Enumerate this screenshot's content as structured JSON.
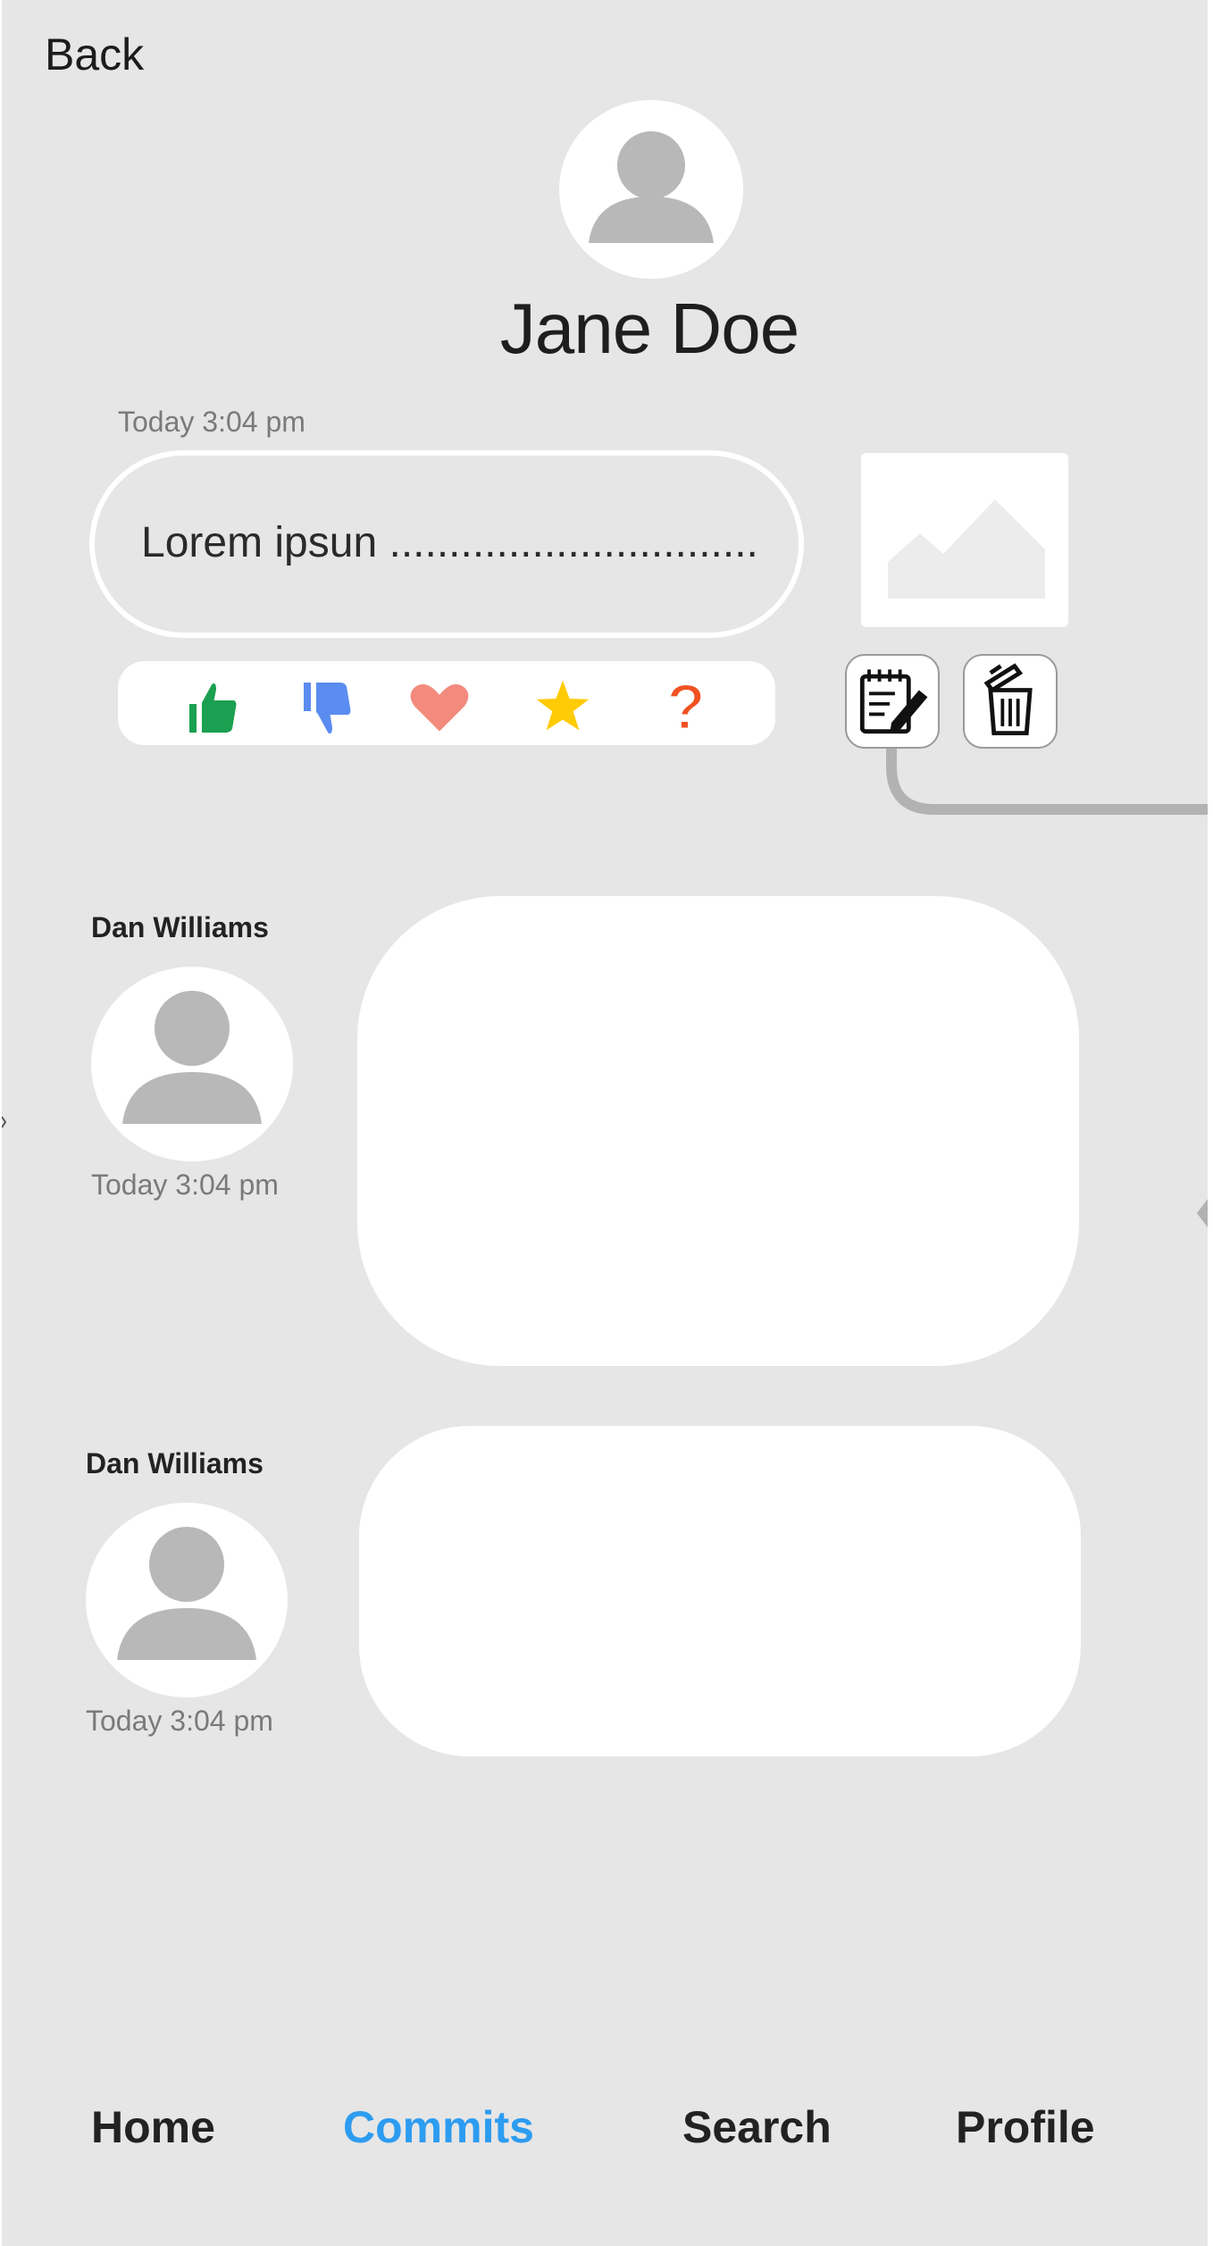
{
  "header": {
    "back_label": "Back"
  },
  "profile": {
    "name": "Jane Doe",
    "avatar_icon": "user-avatar-icon"
  },
  "post": {
    "timestamp": "Today 3:04 pm",
    "text": "Lorem ipsun ...............................",
    "image_icon": "image-placeholder-icon",
    "reactions": [
      {
        "icon": "thumbs-up-icon",
        "color": "#1aa050"
      },
      {
        "icon": "thumbs-down-icon",
        "color": "#5b8cf0"
      },
      {
        "icon": "heart-icon",
        "color": "#f38a7e"
      },
      {
        "icon": "star-icon",
        "color": "#ffcb05"
      },
      {
        "icon": "question-icon",
        "color": "#f05222"
      }
    ],
    "actions": [
      {
        "icon": "edit-notepad-icon"
      },
      {
        "icon": "delete-trash-icon"
      }
    ]
  },
  "comments": [
    {
      "author": "Dan Williams",
      "timestamp": "Today 3:04 pm",
      "body": ""
    },
    {
      "author": "Dan Williams",
      "timestamp": "Today 3:04 pm",
      "body": ""
    }
  ],
  "bottom_nav": {
    "items": [
      {
        "label": "Home",
        "active": false
      },
      {
        "label": "Commits",
        "active": true
      },
      {
        "label": "Search",
        "active": false
      },
      {
        "label": "Profile",
        "active": false
      }
    ],
    "active_color": "#2d9cf0"
  }
}
